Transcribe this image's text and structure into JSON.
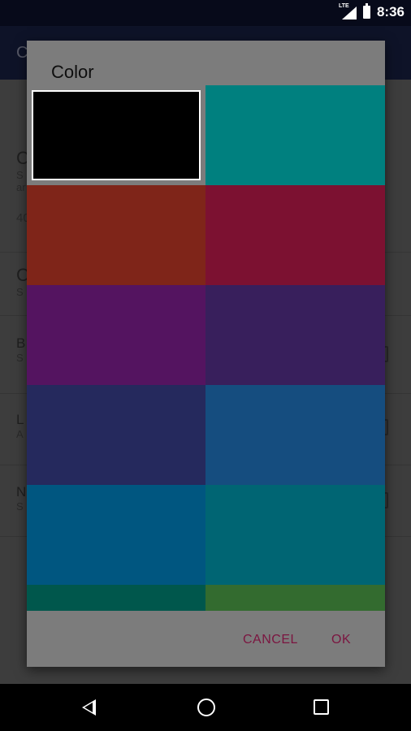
{
  "status_bar": {
    "network": "LTE",
    "time": "8:36"
  },
  "background_app": {
    "title_initial": "C",
    "prefs": [
      {
        "title": "C",
        "summary_1": "S",
        "summary_2": "ar",
        "extra": "40"
      },
      {
        "title": "C",
        "summary_1": "S"
      },
      {
        "title": "B",
        "summary_1": "S"
      },
      {
        "title": "L",
        "summary_1": "A"
      },
      {
        "title": "N",
        "summary_1": "S"
      }
    ]
  },
  "dialog": {
    "title": "Color",
    "selected_index": 0,
    "swatches": [
      {
        "color": "#000000"
      },
      {
        "color": "#00807f"
      },
      {
        "color": "#7f2519"
      },
      {
        "color": "#7c1131"
      },
      {
        "color": "#541460"
      },
      {
        "color": "#381f5c"
      },
      {
        "color": "#25295d"
      },
      {
        "color": "#154d7f"
      },
      {
        "color": "#005680"
      },
      {
        "color": "#006573"
      },
      {
        "color": "#00574c"
      },
      {
        "color": "#336b2f"
      }
    ],
    "actions": {
      "cancel": "CANCEL",
      "ok": "OK"
    }
  },
  "nav_bar": {
    "back_icon": "back-triangle",
    "home_icon": "home-circle",
    "recents_icon": "recents-square"
  }
}
